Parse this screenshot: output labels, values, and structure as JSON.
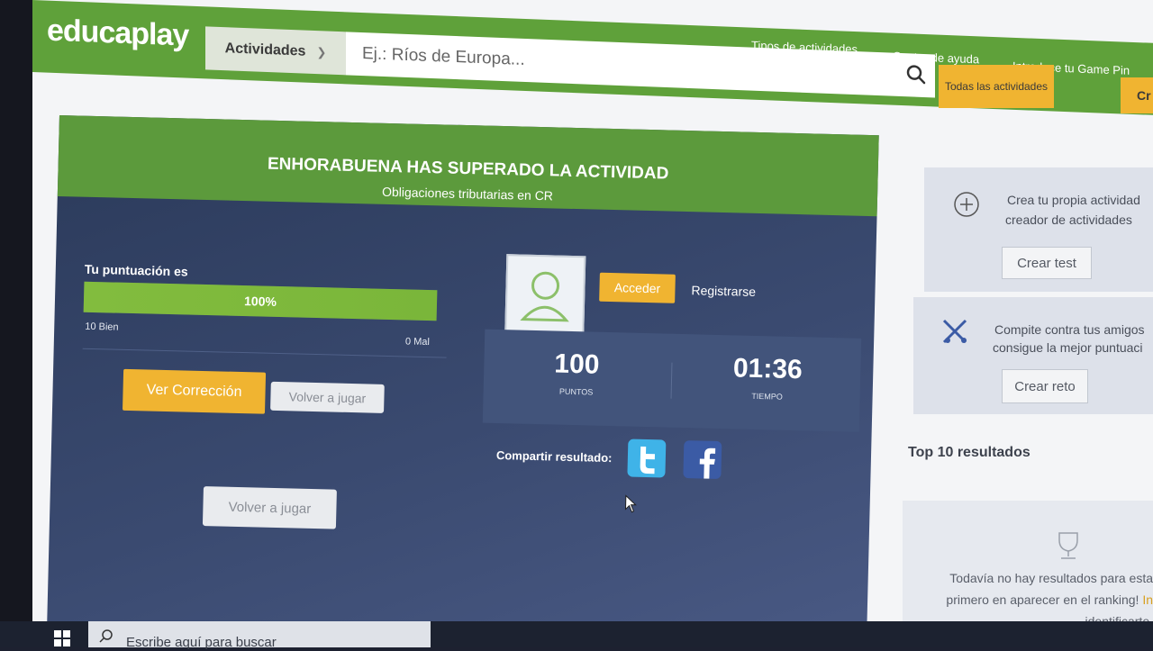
{
  "header": {
    "logo": "educaplay",
    "category_label": "Actividades",
    "search_placeholder": "Ej.: Ríos de Europa...",
    "all_activities_label": "Todas las actividades",
    "create_label": "Cr",
    "links": [
      "Tipos de actividades",
      "Centro de ayuda",
      "Introduce tu Game Pin"
    ]
  },
  "result": {
    "title": "ENHORABUENA HAS SUPERADO LA ACTIVIDAD",
    "subtitle": "Obligaciones tributarias en CR",
    "score_label": "Tu puntuación es",
    "score_percent": 100,
    "score_percent_label": "100%",
    "good_label": "10 Bien",
    "bad_label": "0 Mal",
    "review_button": "Ver Corrección",
    "play_again_button": "Volver a jugar",
    "play_again_button_2": "Volver a jugar",
    "login_button": "Acceder",
    "register_link": "Registrarse",
    "points_value": "100",
    "points_label": "PUNTOS",
    "time_value": "01:36",
    "time_label": "TIEMPO",
    "share_label": "Compartir resultado:",
    "social_icons": [
      "twitter-icon",
      "facebook-icon"
    ]
  },
  "sidebar": {
    "create_text_1": "Crea tu propia actividad",
    "create_text_2": "creador de actividades",
    "create_test_button": "Crear test",
    "challenge_text_1": "Compite contra tus amigos",
    "challenge_text_2": "consigue la mejor puntuaci",
    "create_challenge_button": "Crear reto",
    "top10_title": "Top 10 resultados",
    "empty_line_1": "Todavía no hay resultados para esta",
    "empty_line_2": "primero en aparecer en el ranking! ",
    "empty_line_2_link": "In",
    "empty_line_3": "identificarte."
  },
  "taskbar": {
    "search_text": "Escribe aquí para buscar"
  },
  "colors": {
    "brand_green": "#5fa13a",
    "accent_yellow": "#f0b431",
    "card_navy": "#2f3f63"
  }
}
